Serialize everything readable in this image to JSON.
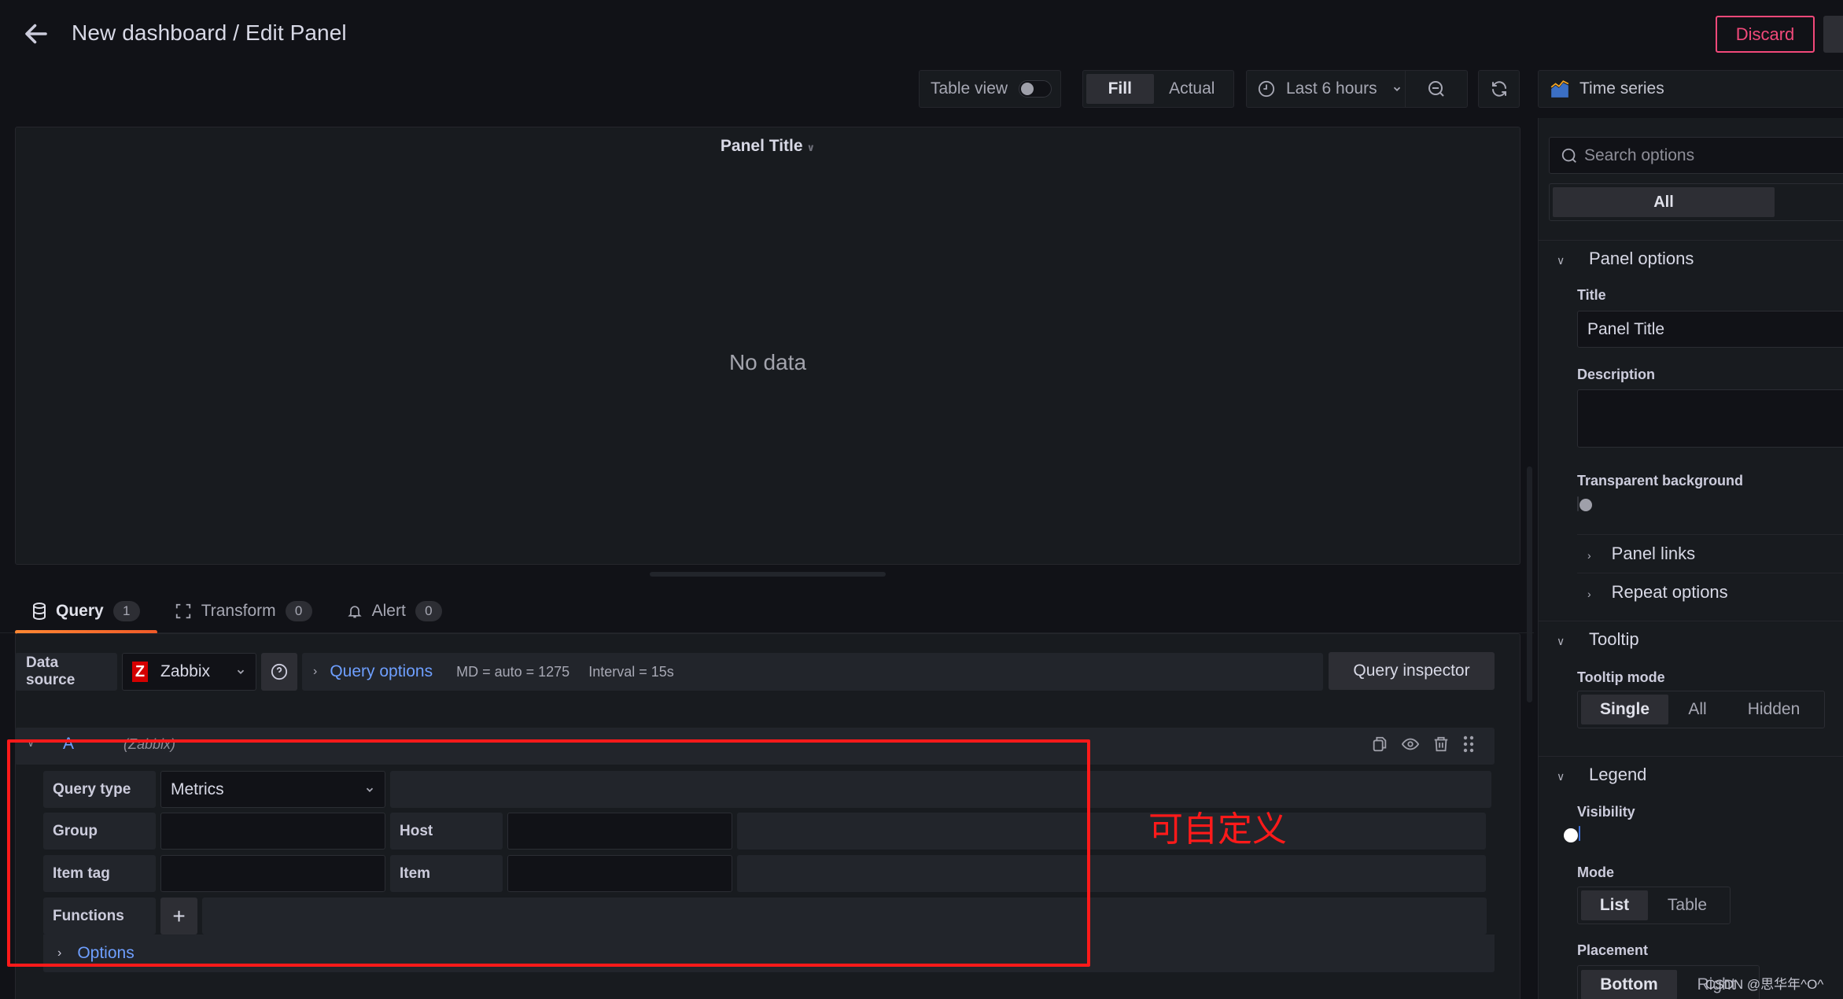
{
  "header": {
    "title": "New dashboard / Edit Panel",
    "discard_label": "Discard"
  },
  "toolbar": {
    "table_view_label": "Table view",
    "table_view_on": false,
    "fill_label": "Fill",
    "actual_label": "Actual",
    "fill_active": "Fill",
    "time_range": "Last 6 hours",
    "visualization": "Time series"
  },
  "preview": {
    "panel_title": "Panel Title",
    "empty_message": "No data"
  },
  "tabs": [
    {
      "label": "Query",
      "count": "1",
      "active": true
    },
    {
      "label": "Transform",
      "count": "0",
      "active": false
    },
    {
      "label": "Alert",
      "count": "0",
      "active": false
    }
  ],
  "datasource": {
    "label": "Data source",
    "selected": "Zabbix",
    "logo_letter": "Z",
    "query_options_label": "Query options",
    "md_info": "MD = auto = 1275",
    "interval_info": "Interval = 15s",
    "query_inspector_label": "Query inspector"
  },
  "query": {
    "ref_id": "A",
    "datasource_hint": "(Zabbix)",
    "fields": {
      "query_type_label": "Query type",
      "query_type_value": "Metrics",
      "group_label": "Group",
      "group_value": "",
      "host_label": "Host",
      "host_value": "",
      "item_tag_label": "Item tag",
      "item_tag_value": "",
      "item_label": "Item",
      "item_value": "",
      "functions_label": "Functions",
      "add_function_symbol": "+"
    },
    "options_label": "Options"
  },
  "annotation": {
    "text": "可自定义",
    "color": "#ff1a1a"
  },
  "options_pane": {
    "search_placeholder": "Search options",
    "filter_all": "All",
    "panel_options": {
      "heading": "Panel options",
      "title_label": "Title",
      "title_value": "Panel Title",
      "description_label": "Description",
      "description_value": "",
      "transparent_label": "Transparent background",
      "transparent_on": false,
      "panel_links": "Panel links",
      "repeat_options": "Repeat options"
    },
    "tooltip": {
      "heading": "Tooltip",
      "mode_label": "Tooltip mode",
      "modes": [
        "Single",
        "All",
        "Hidden"
      ],
      "selected": "Single"
    },
    "legend": {
      "heading": "Legend",
      "visibility_label": "Visibility",
      "visibility_on": true,
      "mode_label": "Mode",
      "modes": [
        "List",
        "Table"
      ],
      "selected_mode": "List",
      "placement_label": "Placement",
      "placements": [
        "Bottom",
        "Right"
      ],
      "selected_placement": "Bottom"
    }
  },
  "colors": {
    "accent_blue": "#6e9fff",
    "discard_red": "#f2497a",
    "tab_underline": "#ff8833",
    "toggle_on": "#3d71d9",
    "zabbix_red": "#d40000"
  },
  "watermark": "CSDN @思华年^O^"
}
